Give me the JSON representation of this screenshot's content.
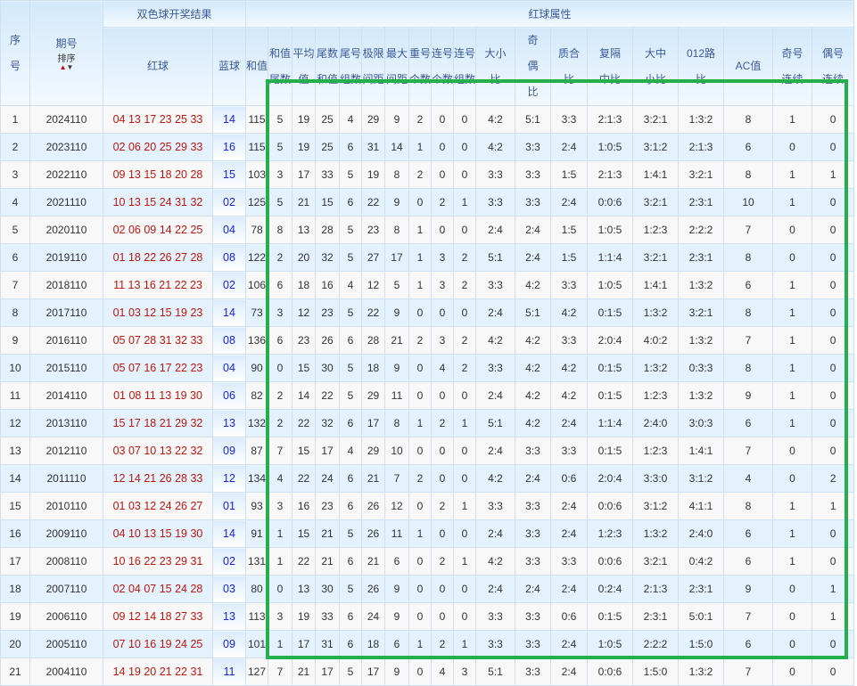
{
  "header": {
    "group_result": "双色球开奖结果",
    "group_attr": "红球属性",
    "col_index": "序号",
    "col_issue": "期号",
    "sort_label": "排序",
    "col_red": "红球",
    "col_blue": "蓝球",
    "col_sum": "和值",
    "attr_cols": [
      "和值尾数",
      "平均值",
      "尾数和值",
      "尾号组数",
      "极限间距",
      "最大间距",
      "重号个数",
      "连号个数",
      "连号组数",
      "大小比",
      "奇偶比",
      "质合比",
      "复隔中比",
      "大中小比",
      "012路比",
      "AC值",
      "奇号连续",
      "偶号连续"
    ]
  },
  "colors": {
    "red_ball": "#c0150e",
    "blue_ball": "#1522e8",
    "highlight_box": "#23b04a"
  },
  "rows": [
    {
      "idx": "1",
      "issue": "2024110",
      "red": "04 13 17 23 25 33",
      "blue": "14",
      "sum": "115",
      "attrs": [
        "5",
        "19",
        "25",
        "4",
        "29",
        "9",
        "2",
        "0",
        "0",
        "4:2",
        "5:1",
        "3:3",
        "2:1:3",
        "3:2:1",
        "1:3:2",
        "8",
        "1",
        "0"
      ]
    },
    {
      "idx": "2",
      "issue": "2023110",
      "red": "02 06 20 25 29 33",
      "blue": "16",
      "sum": "115",
      "attrs": [
        "5",
        "19",
        "25",
        "6",
        "31",
        "14",
        "1",
        "0",
        "0",
        "4:2",
        "3:3",
        "2:4",
        "1:0:5",
        "3:1:2",
        "2:1:3",
        "6",
        "0",
        "0"
      ]
    },
    {
      "idx": "3",
      "issue": "2022110",
      "red": "09 13 15 18 20 28",
      "blue": "15",
      "sum": "103",
      "attrs": [
        "3",
        "17",
        "33",
        "5",
        "19",
        "8",
        "2",
        "0",
        "0",
        "3:3",
        "3:3",
        "1:5",
        "2:1:3",
        "1:4:1",
        "3:2:1",
        "8",
        "1",
        "1"
      ]
    },
    {
      "idx": "4",
      "issue": "2021110",
      "red": "10 13 15 24 31 32",
      "blue": "02",
      "sum": "125",
      "attrs": [
        "5",
        "21",
        "15",
        "6",
        "22",
        "9",
        "0",
        "2",
        "1",
        "3:3",
        "3:3",
        "2:4",
        "0:0:6",
        "3:2:1",
        "2:3:1",
        "10",
        "1",
        "0"
      ]
    },
    {
      "idx": "5",
      "issue": "2020110",
      "red": "02 06 09 14 22 25",
      "blue": "04",
      "sum": "78",
      "attrs": [
        "8",
        "13",
        "28",
        "5",
        "23",
        "8",
        "1",
        "0",
        "0",
        "2:4",
        "2:4",
        "1:5",
        "1:0:5",
        "1:2:3",
        "2:2:2",
        "7",
        "0",
        "0"
      ]
    },
    {
      "idx": "6",
      "issue": "2019110",
      "red": "01 18 22 26 27 28",
      "blue": "08",
      "sum": "122",
      "attrs": [
        "2",
        "20",
        "32",
        "5",
        "27",
        "17",
        "1",
        "3",
        "2",
        "5:1",
        "2:4",
        "1:5",
        "1:1:4",
        "3:2:1",
        "2:3:1",
        "8",
        "0",
        "0"
      ]
    },
    {
      "idx": "7",
      "issue": "2018110",
      "red": "11 13 16 21 22 23",
      "blue": "02",
      "sum": "106",
      "attrs": [
        "6",
        "18",
        "16",
        "4",
        "12",
        "5",
        "1",
        "3",
        "2",
        "3:3",
        "4:2",
        "3:3",
        "1:0:5",
        "1:4:1",
        "1:3:2",
        "6",
        "1",
        "0"
      ]
    },
    {
      "idx": "8",
      "issue": "2017110",
      "red": "01 03 12 15 19 23",
      "blue": "14",
      "sum": "73",
      "attrs": [
        "3",
        "12",
        "23",
        "5",
        "22",
        "9",
        "0",
        "0",
        "0",
        "2:4",
        "5:1",
        "4:2",
        "0:1:5",
        "1:3:2",
        "3:2:1",
        "8",
        "1",
        "0"
      ]
    },
    {
      "idx": "9",
      "issue": "2016110",
      "red": "05 07 28 31 32 33",
      "blue": "08",
      "sum": "136",
      "attrs": [
        "6",
        "23",
        "26",
        "6",
        "28",
        "21",
        "2",
        "3",
        "2",
        "4:2",
        "4:2",
        "3:3",
        "2:0:4",
        "4:0:2",
        "1:3:2",
        "7",
        "1",
        "0"
      ]
    },
    {
      "idx": "10",
      "issue": "2015110",
      "red": "05 07 16 17 22 23",
      "blue": "04",
      "sum": "90",
      "attrs": [
        "0",
        "15",
        "30",
        "5",
        "18",
        "9",
        "0",
        "4",
        "2",
        "3:3",
        "4:2",
        "4:2",
        "0:1:5",
        "1:3:2",
        "0:3:3",
        "8",
        "1",
        "0"
      ]
    },
    {
      "idx": "11",
      "issue": "2014110",
      "red": "01 08 11 13 19 30",
      "blue": "06",
      "sum": "82",
      "attrs": [
        "2",
        "14",
        "22",
        "5",
        "29",
        "11",
        "0",
        "0",
        "0",
        "2:4",
        "4:2",
        "4:2",
        "0:1:5",
        "1:2:3",
        "1:3:2",
        "9",
        "1",
        "0"
      ]
    },
    {
      "idx": "12",
      "issue": "2013110",
      "red": "15 17 18 21 29 32",
      "blue": "13",
      "sum": "132",
      "attrs": [
        "2",
        "22",
        "32",
        "6",
        "17",
        "8",
        "1",
        "2",
        "1",
        "5:1",
        "4:2",
        "2:4",
        "1:1:4",
        "2:4:0",
        "3:0:3",
        "6",
        "1",
        "0"
      ]
    },
    {
      "idx": "13",
      "issue": "2012110",
      "red": "03 07 10 13 22 32",
      "blue": "09",
      "sum": "87",
      "attrs": [
        "7",
        "15",
        "17",
        "4",
        "29",
        "10",
        "0",
        "0",
        "0",
        "2:4",
        "3:3",
        "3:3",
        "0:1:5",
        "1:2:3",
        "1:4:1",
        "7",
        "0",
        "0"
      ]
    },
    {
      "idx": "14",
      "issue": "2011110",
      "red": "12 14 21 26 28 33",
      "blue": "12",
      "sum": "134",
      "attrs": [
        "4",
        "22",
        "24",
        "6",
        "21",
        "7",
        "2",
        "0",
        "0",
        "4:2",
        "2:4",
        "0:6",
        "2:0:4",
        "3:3:0",
        "3:1:2",
        "4",
        "0",
        "2"
      ]
    },
    {
      "idx": "15",
      "issue": "2010110",
      "red": "01 03 12 24 26 27",
      "blue": "01",
      "sum": "93",
      "attrs": [
        "3",
        "16",
        "23",
        "6",
        "26",
        "12",
        "0",
        "2",
        "1",
        "3:3",
        "3:3",
        "2:4",
        "0:0:6",
        "3:1:2",
        "4:1:1",
        "8",
        "1",
        "1"
      ]
    },
    {
      "idx": "16",
      "issue": "2009110",
      "red": "04 10 13 15 19 30",
      "blue": "14",
      "sum": "91",
      "attrs": [
        "1",
        "15",
        "21",
        "5",
        "26",
        "11",
        "1",
        "0",
        "0",
        "2:4",
        "3:3",
        "2:4",
        "1:2:3",
        "1:3:2",
        "2:4:0",
        "6",
        "1",
        "0"
      ]
    },
    {
      "idx": "17",
      "issue": "2008110",
      "red": "10 16 22 23 29 31",
      "blue": "02",
      "sum": "131",
      "attrs": [
        "1",
        "22",
        "21",
        "6",
        "21",
        "6",
        "0",
        "2",
        "1",
        "4:2",
        "3:3",
        "3:3",
        "0:0:6",
        "3:2:1",
        "0:4:2",
        "6",
        "1",
        "0"
      ]
    },
    {
      "idx": "18",
      "issue": "2007110",
      "red": "02 04 07 15 24 28",
      "blue": "03",
      "sum": "80",
      "attrs": [
        "0",
        "13",
        "30",
        "5",
        "26",
        "9",
        "0",
        "0",
        "0",
        "2:4",
        "2:4",
        "2:4",
        "0:2:4",
        "2:1:3",
        "2:3:1",
        "9",
        "0",
        "1"
      ]
    },
    {
      "idx": "19",
      "issue": "2006110",
      "red": "09 12 14 18 27 33",
      "blue": "13",
      "sum": "113",
      "attrs": [
        "3",
        "19",
        "33",
        "6",
        "24",
        "9",
        "0",
        "0",
        "0",
        "3:3",
        "3:3",
        "0:6",
        "0:1:5",
        "2:3:1",
        "5:0:1",
        "7",
        "0",
        "1"
      ]
    },
    {
      "idx": "20",
      "issue": "2005110",
      "red": "07 10 16 19 24 25",
      "blue": "09",
      "sum": "101",
      "attrs": [
        "1",
        "17",
        "31",
        "6",
        "18",
        "6",
        "1",
        "2",
        "1",
        "3:3",
        "3:3",
        "2:4",
        "1:0:5",
        "2:2:2",
        "1:5:0",
        "6",
        "0",
        "0"
      ]
    },
    {
      "idx": "21",
      "issue": "2004110",
      "red": "14 19 20 21 22 31",
      "blue": "11",
      "sum": "127",
      "attrs": [
        "7",
        "21",
        "17",
        "5",
        "17",
        "9",
        "0",
        "4",
        "3",
        "5:1",
        "3:3",
        "2:4",
        "0:0:6",
        "1:5:0",
        "1:3:2",
        "7",
        "0",
        "0"
      ]
    }
  ]
}
